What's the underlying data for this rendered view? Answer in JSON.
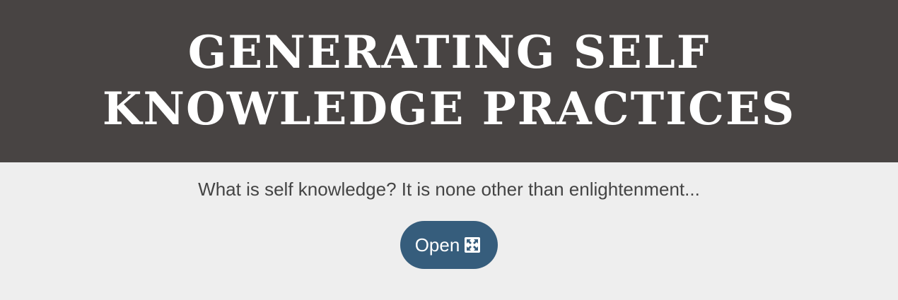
{
  "header": {
    "title": "GENERATING SELF KNOWLEDGE PRACTICES"
  },
  "main": {
    "subtitle": "What is self knowledge? It is none other than enlightenment...",
    "open_button": {
      "label": "Open",
      "icon": "expand-arrows-icon"
    }
  },
  "colors": {
    "header_background": "#484443",
    "page_background": "#eeeeee",
    "button_background": "#365d7c",
    "text": "#444444"
  }
}
